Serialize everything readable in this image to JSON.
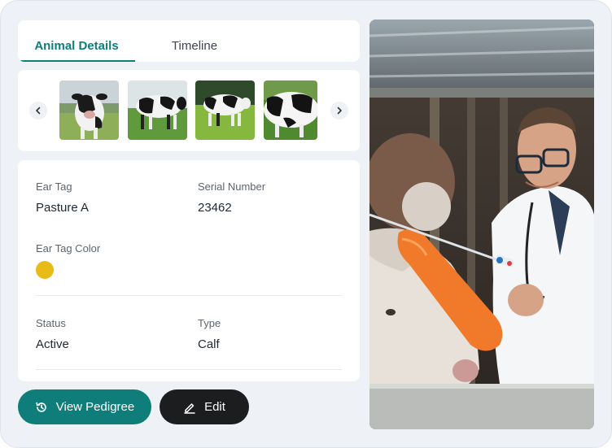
{
  "tabs": [
    {
      "label": "Animal Details",
      "active": true
    },
    {
      "label": "Timeline",
      "active": false
    }
  ],
  "gallery": {
    "thumbnails": [
      {
        "alt": "cow-photo-1"
      },
      {
        "alt": "cow-photo-2"
      },
      {
        "alt": "cow-photo-3"
      },
      {
        "alt": "cow-photo-4"
      }
    ]
  },
  "details": {
    "ear_tag": {
      "label": "Ear Tag",
      "value": "Pasture A"
    },
    "serial_number": {
      "label": "Serial Number",
      "value": "23462"
    },
    "ear_tag_color": {
      "label": "Ear Tag Color",
      "color": "#e8bb16"
    },
    "status": {
      "label": "Status",
      "value": "Active"
    },
    "type": {
      "label": "Type",
      "value": "Calf"
    }
  },
  "actions": {
    "view_pedigree": "View Pedigree",
    "edit": "Edit"
  },
  "colors": {
    "accent": "#0f7e7b",
    "dark_button": "#1c1d1f",
    "background": "#eef1f5"
  }
}
